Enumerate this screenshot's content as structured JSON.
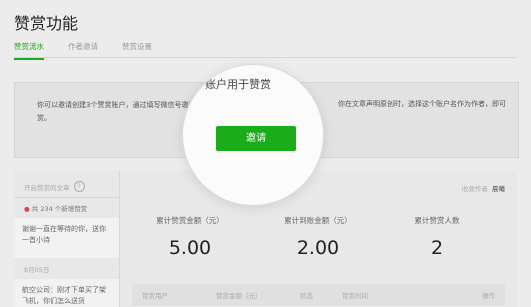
{
  "header": {
    "title": "赞赏功能",
    "tabs": [
      {
        "label": "赞赏流水",
        "active": true
      },
      {
        "label": "作者邀请",
        "active": false
      },
      {
        "label": "赞赏设置",
        "active": false
      }
    ]
  },
  "notice": {
    "left_text": "你可以邀请创建3个赞赏账户，通过填写微信号邀请 开启赞赏。",
    "right_text": "你在文章声明原创时，选择这个账户名作为作者，即可"
  },
  "magnifier": {
    "text": "账户用于赞赏",
    "invite_label": "邀请"
  },
  "sidebar": {
    "header": "开启赞赏的文章",
    "new_count_text": "共 234 个新增赞赏",
    "card1": "谢谢一直在等待的你，送你一首小诗",
    "date": "8月05日",
    "card2": "航空公司：刚才下单买了架飞机，你们怎么送货"
  },
  "main": {
    "recipient_label": "收款作者",
    "recipient_name": "晨曦",
    "stats": [
      {
        "label": "累计赞赏金额（元）",
        "value": "5.00"
      },
      {
        "label": "累计到账金额（元）",
        "value": "2.00"
      },
      {
        "label": "累计赞赏人数",
        "value": "2"
      }
    ],
    "table_headers": [
      "赞赏用户",
      "赞赏金额（元）",
      "状态",
      "赞赏时间",
      "操作"
    ]
  },
  "colors": {
    "accent": "#1aad19",
    "new_dot": "#e64340"
  }
}
